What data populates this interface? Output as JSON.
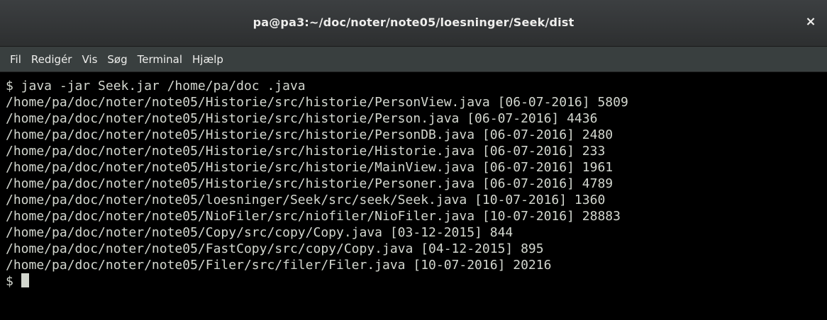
{
  "window": {
    "title": "pa@pa3:~/doc/noter/note05/loesninger/Seek/dist",
    "close_glyph": "×"
  },
  "menu": {
    "items": [
      "Fil",
      "Redigér",
      "Vis",
      "Søg",
      "Terminal",
      "Hjælp"
    ]
  },
  "terminal": {
    "lines": [
      "$ java -jar Seek.jar /home/pa/doc .java",
      "/home/pa/doc/noter/note05/Historie/src/historie/PersonView.java [06-07-2016] 5809",
      "/home/pa/doc/noter/note05/Historie/src/historie/Person.java [06-07-2016] 4436",
      "/home/pa/doc/noter/note05/Historie/src/historie/PersonDB.java [06-07-2016] 2480",
      "/home/pa/doc/noter/note05/Historie/src/historie/Historie.java [06-07-2016] 233",
      "/home/pa/doc/noter/note05/Historie/src/historie/MainView.java [06-07-2016] 1961",
      "/home/pa/doc/noter/note05/Historie/src/historie/Personer.java [06-07-2016] 4789",
      "/home/pa/doc/noter/note05/loesninger/Seek/src/seek/Seek.java [10-07-2016] 1360",
      "/home/pa/doc/noter/note05/NioFiler/src/niofiler/NioFiler.java [10-07-2016] 28883",
      "/home/pa/doc/noter/note05/Copy/src/copy/Copy.java [03-12-2015] 844",
      "/home/pa/doc/noter/note05/FastCopy/src/copy/Copy.java [04-12-2015] 895",
      "/home/pa/doc/noter/note05/Filer/src/filer/Filer.java [10-07-2016] 20216"
    ],
    "prompt": "$ "
  }
}
